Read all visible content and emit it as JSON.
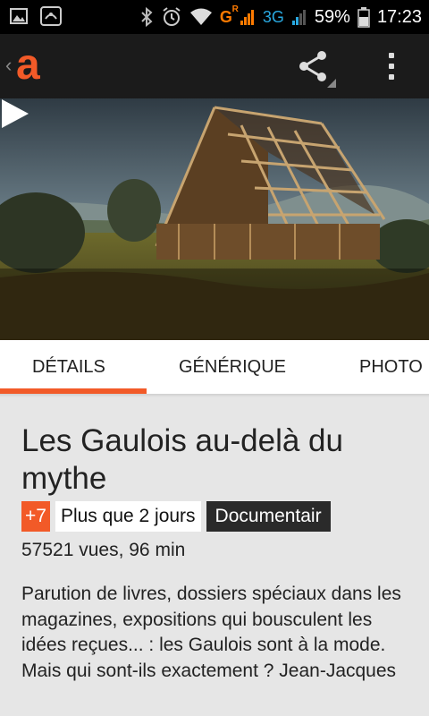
{
  "status_bar": {
    "network_g": "G",
    "network_r": "R",
    "network_3g": "3G",
    "battery": "59%",
    "time": "17:23"
  },
  "app_bar": {
    "logo": "a",
    "brand_color": "#f25a28"
  },
  "tabs": [
    {
      "label": "DÉTAILS",
      "selected": true
    },
    {
      "label": "GÉNÉRIQUE",
      "selected": false
    },
    {
      "label": "PHOTO",
      "selected": false
    }
  ],
  "program": {
    "title": "Les Gaulois au-delà du mythe",
    "age_rating": "+7",
    "availability": "Plus que 2 jours",
    "genre": "Documentair",
    "meta": "57521 vues, 96 min",
    "description": "Parution de livres, dossiers spéciaux dans les magazines, expositions qui bousculent les idées reçues... : les Gaulois sont à la mode. Mais qui sont-ils exactement ? Jean-Jacques"
  },
  "icons": {
    "back": "chevron-left-icon",
    "share": "share-icon",
    "more": "more-vert-icon",
    "play": "play-icon"
  }
}
